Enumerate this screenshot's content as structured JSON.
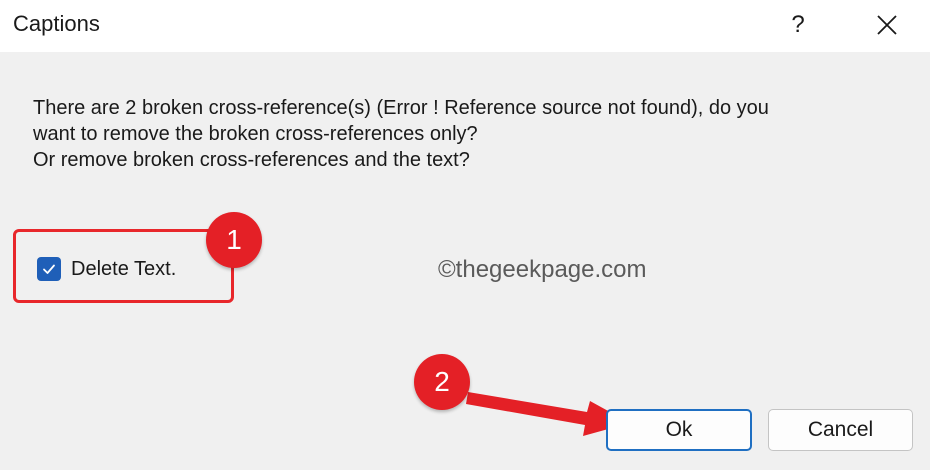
{
  "window": {
    "title": "Captions",
    "help_label": "?",
    "close_icon": "close-icon"
  },
  "message": {
    "line1": "There are 2 broken cross-reference(s) (Error ! Reference source not found), do you",
    "line2": "want to remove the broken cross-references only?",
    "line3": "Or remove broken cross-references and the text?"
  },
  "checkbox": {
    "label": "Delete Text.",
    "checked": true,
    "icon": "checkmark-icon"
  },
  "annotations": {
    "badge1": "1",
    "badge2": "2",
    "accent_color": "#e42026"
  },
  "watermark": "©thegeekpage.com",
  "buttons": {
    "ok_label": "Ok",
    "cancel_label": "Cancel",
    "ok_border_color": "#1f6fc2"
  }
}
